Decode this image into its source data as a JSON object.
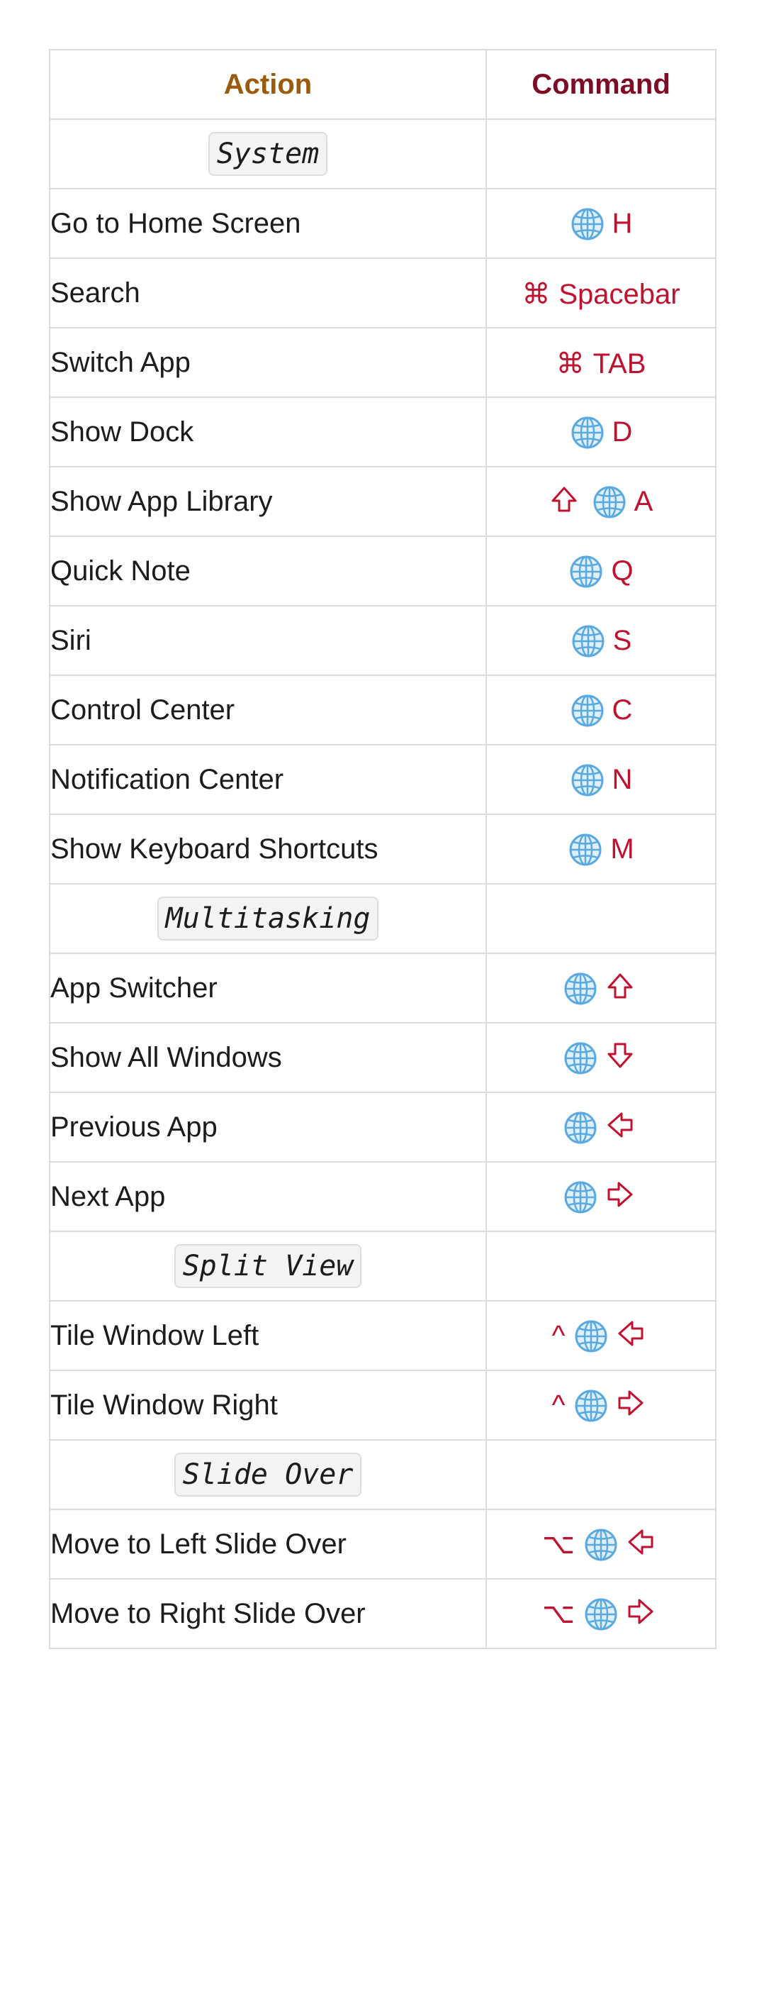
{
  "header": {
    "action": "Action",
    "command": "Command"
  },
  "colors": {
    "action_header": "#9a5b0c",
    "command_header": "#7d0d24",
    "command_text": "#c0112f",
    "border": "#dcdcdc",
    "globe": "#5aa9e0"
  },
  "rows": [
    {
      "type": "section",
      "label": "System"
    },
    {
      "type": "shortcut",
      "action": "Go to Home Screen",
      "keys": [
        {
          "icon": "globe-icon"
        },
        {
          "text": "H"
        }
      ]
    },
    {
      "type": "shortcut",
      "action": "Search",
      "keys": [
        {
          "text": "⌘"
        },
        {
          "text": "Spacebar"
        }
      ]
    },
    {
      "type": "shortcut",
      "action": "Switch App",
      "keys": [
        {
          "text": "⌘"
        },
        {
          "text": "TAB"
        }
      ]
    },
    {
      "type": "shortcut",
      "action": "Show Dock",
      "keys": [
        {
          "icon": "globe-icon"
        },
        {
          "text": "D"
        }
      ]
    },
    {
      "type": "shortcut",
      "action": "Show App Library",
      "keys": [
        {
          "icon": "shift-arrow-up-icon"
        },
        {
          "icon": "globe-icon"
        },
        {
          "text": "A"
        }
      ]
    },
    {
      "type": "shortcut",
      "action": "Quick Note",
      "keys": [
        {
          "icon": "globe-icon"
        },
        {
          "text": "Q"
        }
      ]
    },
    {
      "type": "shortcut",
      "action": "Siri",
      "keys": [
        {
          "icon": "globe-icon"
        },
        {
          "text": "S"
        }
      ]
    },
    {
      "type": "shortcut",
      "action": "Control Center",
      "keys": [
        {
          "icon": "globe-icon"
        },
        {
          "text": "C"
        }
      ]
    },
    {
      "type": "shortcut",
      "action": "Notification Center",
      "keys": [
        {
          "icon": "globe-icon"
        },
        {
          "text": "N"
        }
      ]
    },
    {
      "type": "shortcut",
      "action": "Show Keyboard Shortcuts",
      "keys": [
        {
          "icon": "globe-icon"
        },
        {
          "text": "M"
        }
      ]
    },
    {
      "type": "section",
      "label": "Multitasking"
    },
    {
      "type": "shortcut",
      "action": "App Switcher",
      "keys": [
        {
          "icon": "globe-icon"
        },
        {
          "icon": "arrow-up-icon"
        }
      ]
    },
    {
      "type": "shortcut",
      "action": "Show All Windows",
      "keys": [
        {
          "icon": "globe-icon"
        },
        {
          "icon": "arrow-down-icon"
        }
      ]
    },
    {
      "type": "shortcut",
      "action": "Previous App",
      "keys": [
        {
          "icon": "globe-icon"
        },
        {
          "icon": "arrow-left-icon"
        }
      ]
    },
    {
      "type": "shortcut",
      "action": "Next App",
      "keys": [
        {
          "icon": "globe-icon"
        },
        {
          "icon": "arrow-right-icon"
        }
      ]
    },
    {
      "type": "section",
      "label": "Split View"
    },
    {
      "type": "shortcut",
      "action": "Tile Window Left",
      "keys": [
        {
          "text": "^"
        },
        {
          "icon": "globe-icon"
        },
        {
          "icon": "arrow-left-icon"
        }
      ]
    },
    {
      "type": "shortcut",
      "action": "Tile Window Right",
      "keys": [
        {
          "text": "^"
        },
        {
          "icon": "globe-icon"
        },
        {
          "icon": "arrow-right-icon"
        }
      ]
    },
    {
      "type": "section",
      "label": "Slide Over"
    },
    {
      "type": "shortcut",
      "action": "Move to Left Slide Over",
      "keys": [
        {
          "text": "⌥"
        },
        {
          "icon": "globe-icon"
        },
        {
          "icon": "arrow-left-icon"
        }
      ]
    },
    {
      "type": "shortcut",
      "action": "Move to Right Slide Over",
      "keys": [
        {
          "text": "⌥"
        },
        {
          "icon": "globe-icon"
        },
        {
          "icon": "arrow-right-icon"
        }
      ]
    }
  ]
}
